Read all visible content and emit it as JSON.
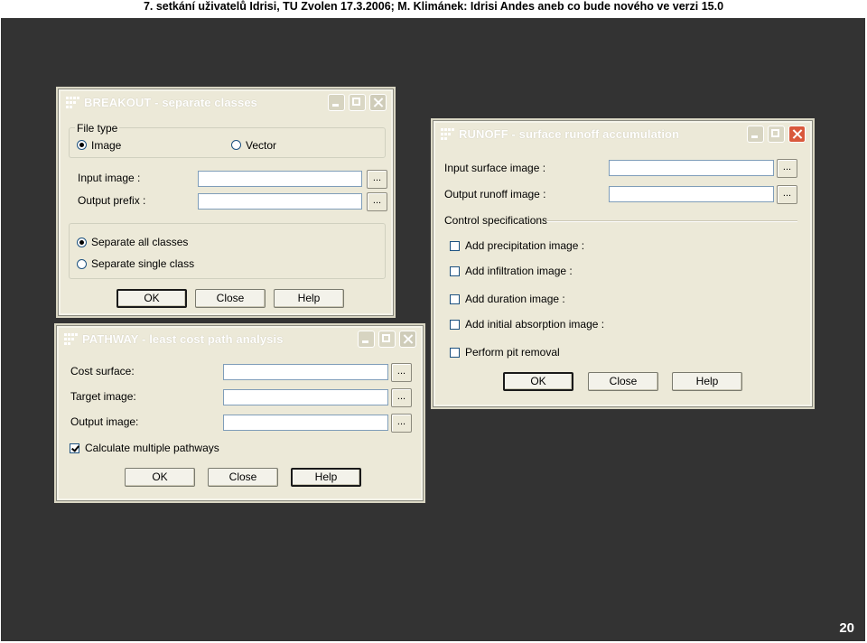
{
  "slide": {
    "header": "7. setkání uživatelů Idrisi, TU Zvolen 17.3.2006; M. Klimánek: Idrisi Andes aneb co bude nového ve verzi 15.0",
    "page_number": "20"
  },
  "breakout": {
    "title": "BREAKOUT - separate classes",
    "file_type": "File type",
    "image": "Image",
    "vector": "Vector",
    "input_label": "Input image :",
    "output_label": "Output prefix :",
    "sep_all": "Separate all classes",
    "sep_single": "Separate single class",
    "ok": "OK",
    "close": "Close",
    "help": "Help",
    "browse": "..."
  },
  "pathway": {
    "title": "PATHWAY - least cost path analysis",
    "cost_label": "Cost surface:",
    "target_label": "Target image:",
    "output_label": "Output image:",
    "multi_label": "Calculate multiple pathways",
    "ok": "OK",
    "close": "Close",
    "help": "Help",
    "browse": "..."
  },
  "runoff": {
    "title": "RUNOFF - surface runoff accumulation",
    "input_label": "Input surface image :",
    "output_label": "Output runoff image :",
    "control_label": "Control specifications",
    "opt_precip": "Add precipitation image :",
    "opt_infil": "Add infiltration image :",
    "opt_duration": "Add duration image :",
    "opt_absorb": "Add initial absorption image :",
    "opt_pit": "Perform pit removal",
    "ok": "OK",
    "close": "Close",
    "help": "Help",
    "browse": "..."
  }
}
